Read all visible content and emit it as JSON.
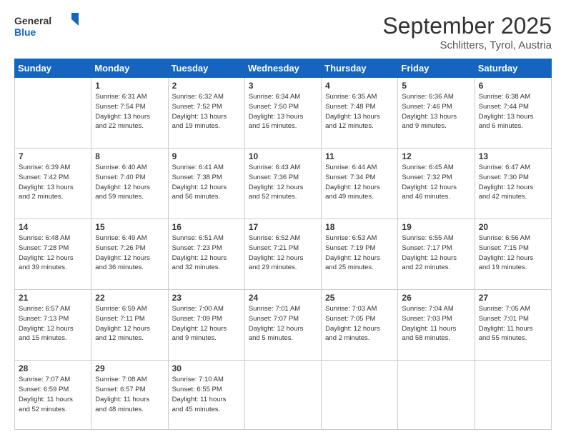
{
  "header": {
    "logo_general": "General",
    "logo_blue": "Blue",
    "month_year": "September 2025",
    "location": "Schlitters, Tyrol, Austria"
  },
  "days_of_week": [
    "Sunday",
    "Monday",
    "Tuesday",
    "Wednesday",
    "Thursday",
    "Friday",
    "Saturday"
  ],
  "weeks": [
    [
      {
        "day": "",
        "info": ""
      },
      {
        "day": "1",
        "info": "Sunrise: 6:31 AM\nSunset: 7:54 PM\nDaylight: 13 hours\nand 22 minutes."
      },
      {
        "day": "2",
        "info": "Sunrise: 6:32 AM\nSunset: 7:52 PM\nDaylight: 13 hours\nand 19 minutes."
      },
      {
        "day": "3",
        "info": "Sunrise: 6:34 AM\nSunset: 7:50 PM\nDaylight: 13 hours\nand 16 minutes."
      },
      {
        "day": "4",
        "info": "Sunrise: 6:35 AM\nSunset: 7:48 PM\nDaylight: 13 hours\nand 12 minutes."
      },
      {
        "day": "5",
        "info": "Sunrise: 6:36 AM\nSunset: 7:46 PM\nDaylight: 13 hours\nand 9 minutes."
      },
      {
        "day": "6",
        "info": "Sunrise: 6:38 AM\nSunset: 7:44 PM\nDaylight: 13 hours\nand 6 minutes."
      }
    ],
    [
      {
        "day": "7",
        "info": "Sunrise: 6:39 AM\nSunset: 7:42 PM\nDaylight: 13 hours\nand 2 minutes."
      },
      {
        "day": "8",
        "info": "Sunrise: 6:40 AM\nSunset: 7:40 PM\nDaylight: 12 hours\nand 59 minutes."
      },
      {
        "day": "9",
        "info": "Sunrise: 6:41 AM\nSunset: 7:38 PM\nDaylight: 12 hours\nand 56 minutes."
      },
      {
        "day": "10",
        "info": "Sunrise: 6:43 AM\nSunset: 7:36 PM\nDaylight: 12 hours\nand 52 minutes."
      },
      {
        "day": "11",
        "info": "Sunrise: 6:44 AM\nSunset: 7:34 PM\nDaylight: 12 hours\nand 49 minutes."
      },
      {
        "day": "12",
        "info": "Sunrise: 6:45 AM\nSunset: 7:32 PM\nDaylight: 12 hours\nand 46 minutes."
      },
      {
        "day": "13",
        "info": "Sunrise: 6:47 AM\nSunset: 7:30 PM\nDaylight: 12 hours\nand 42 minutes."
      }
    ],
    [
      {
        "day": "14",
        "info": "Sunrise: 6:48 AM\nSunset: 7:28 PM\nDaylight: 12 hours\nand 39 minutes."
      },
      {
        "day": "15",
        "info": "Sunrise: 6:49 AM\nSunset: 7:26 PM\nDaylight: 12 hours\nand 36 minutes."
      },
      {
        "day": "16",
        "info": "Sunrise: 6:51 AM\nSunset: 7:23 PM\nDaylight: 12 hours\nand 32 minutes."
      },
      {
        "day": "17",
        "info": "Sunrise: 6:52 AM\nSunset: 7:21 PM\nDaylight: 12 hours\nand 29 minutes."
      },
      {
        "day": "18",
        "info": "Sunrise: 6:53 AM\nSunset: 7:19 PM\nDaylight: 12 hours\nand 25 minutes."
      },
      {
        "day": "19",
        "info": "Sunrise: 6:55 AM\nSunset: 7:17 PM\nDaylight: 12 hours\nand 22 minutes."
      },
      {
        "day": "20",
        "info": "Sunrise: 6:56 AM\nSunset: 7:15 PM\nDaylight: 12 hours\nand 19 minutes."
      }
    ],
    [
      {
        "day": "21",
        "info": "Sunrise: 6:57 AM\nSunset: 7:13 PM\nDaylight: 12 hours\nand 15 minutes."
      },
      {
        "day": "22",
        "info": "Sunrise: 6:59 AM\nSunset: 7:11 PM\nDaylight: 12 hours\nand 12 minutes."
      },
      {
        "day": "23",
        "info": "Sunrise: 7:00 AM\nSunset: 7:09 PM\nDaylight: 12 hours\nand 9 minutes."
      },
      {
        "day": "24",
        "info": "Sunrise: 7:01 AM\nSunset: 7:07 PM\nDaylight: 12 hours\nand 5 minutes."
      },
      {
        "day": "25",
        "info": "Sunrise: 7:03 AM\nSunset: 7:05 PM\nDaylight: 12 hours\nand 2 minutes."
      },
      {
        "day": "26",
        "info": "Sunrise: 7:04 AM\nSunset: 7:03 PM\nDaylight: 11 hours\nand 58 minutes."
      },
      {
        "day": "27",
        "info": "Sunrise: 7:05 AM\nSunset: 7:01 PM\nDaylight: 11 hours\nand 55 minutes."
      }
    ],
    [
      {
        "day": "28",
        "info": "Sunrise: 7:07 AM\nSunset: 6:59 PM\nDaylight: 11 hours\nand 52 minutes."
      },
      {
        "day": "29",
        "info": "Sunrise: 7:08 AM\nSunset: 6:57 PM\nDaylight: 11 hours\nand 48 minutes."
      },
      {
        "day": "30",
        "info": "Sunrise: 7:10 AM\nSunset: 6:55 PM\nDaylight: 11 hours\nand 45 minutes."
      },
      {
        "day": "",
        "info": ""
      },
      {
        "day": "",
        "info": ""
      },
      {
        "day": "",
        "info": ""
      },
      {
        "day": "",
        "info": ""
      }
    ]
  ]
}
